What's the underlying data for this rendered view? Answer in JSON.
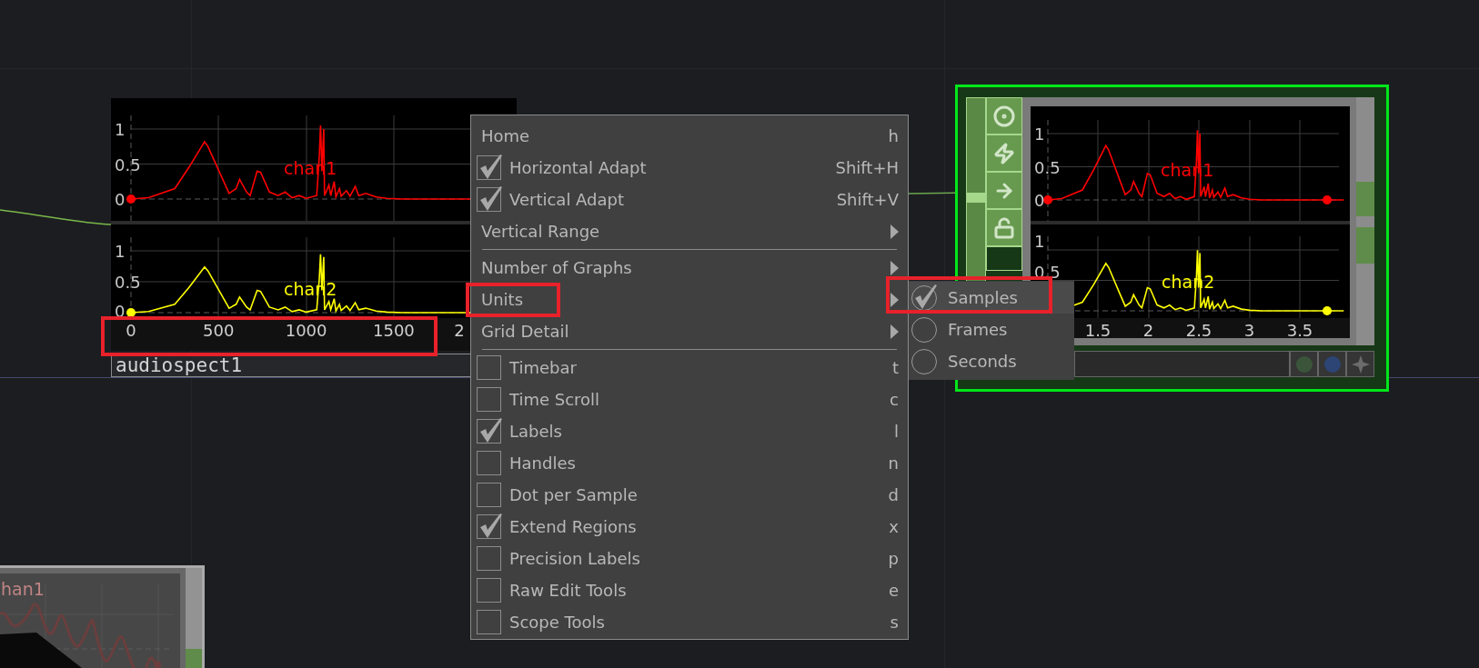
{
  "left_node": {
    "channels": [
      {
        "label": "chan1",
        "color": "#ff0000",
        "y_labels": [
          "1",
          "0.5",
          "0"
        ]
      },
      {
        "label": "chan2",
        "color": "#ffff00",
        "y_labels": [
          "1",
          "0.5",
          "0"
        ]
      }
    ],
    "x_labels": [
      "0",
      "500",
      "1000",
      "1500",
      "2"
    ],
    "name": "audiospect1"
  },
  "context_menu": {
    "sections": [
      [
        {
          "kind": "action",
          "label": "Home",
          "shortcut": "h"
        },
        {
          "kind": "toggle",
          "label": "Horizontal Adapt",
          "shortcut": "Shift+H",
          "checked": true
        },
        {
          "kind": "toggle",
          "label": "Vertical Adapt",
          "shortcut": "Shift+V",
          "checked": true
        },
        {
          "kind": "submenu",
          "label": "Vertical Range"
        }
      ],
      [
        {
          "kind": "submenu",
          "label": "Number of Graphs"
        },
        {
          "kind": "submenu",
          "label": "Units"
        },
        {
          "kind": "submenu",
          "label": "Grid Detail"
        }
      ],
      [
        {
          "kind": "toggle",
          "label": "Timebar",
          "shortcut": "t",
          "checked": false
        },
        {
          "kind": "toggle",
          "label": "Time Scroll",
          "shortcut": "c",
          "checked": false
        },
        {
          "kind": "toggle",
          "label": "Labels",
          "shortcut": "l",
          "checked": true
        },
        {
          "kind": "toggle",
          "label": "Handles",
          "shortcut": "n",
          "checked": false
        },
        {
          "kind": "toggle",
          "label": "Dot per Sample",
          "shortcut": "d",
          "checked": false
        },
        {
          "kind": "toggle",
          "label": "Extend Regions",
          "shortcut": "x",
          "checked": true
        },
        {
          "kind": "toggle",
          "label": "Precision Labels",
          "shortcut": "p",
          "checked": false
        },
        {
          "kind": "toggle",
          "label": "Raw Edit Tools",
          "shortcut": "e",
          "checked": false
        },
        {
          "kind": "toggle",
          "label": "Scope Tools",
          "shortcut": "s",
          "checked": false
        }
      ]
    ]
  },
  "units_submenu": {
    "options": [
      {
        "label": "Samples",
        "selected": true
      },
      {
        "label": "Frames",
        "selected": false
      },
      {
        "label": "Seconds",
        "selected": false
      }
    ]
  },
  "right_node": {
    "selected": true,
    "channels": [
      {
        "label": "chan1",
        "color": "#ff0000",
        "y_labels": [
          "1",
          "0.5",
          "0"
        ]
      },
      {
        "label": "chan2",
        "color": "#ffff00",
        "y_labels": [
          "1",
          "0.5"
        ]
      }
    ],
    "x_labels": [
      "1.5",
      "2",
      "2.5",
      "3",
      "3.5"
    ]
  },
  "bottom_node": {
    "channel_label": "han1"
  }
}
